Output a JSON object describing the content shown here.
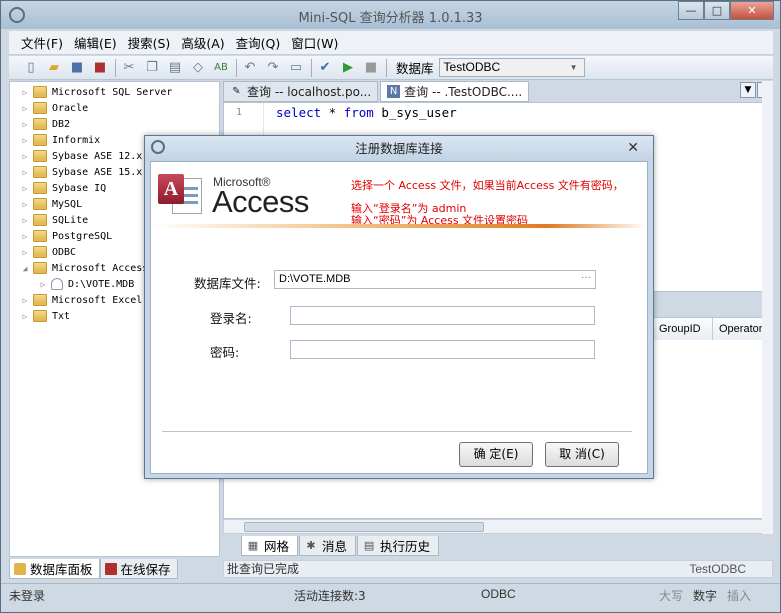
{
  "app": {
    "title": "Mini-SQL 查询分析器 1.0.1.33"
  },
  "window_controls": {
    "minimize": "—",
    "maximize": "□",
    "close": "✕"
  },
  "menu": [
    {
      "label": "文件(F)"
    },
    {
      "label": "编辑(E)"
    },
    {
      "label": "搜索(S)"
    },
    {
      "label": "高级(A)"
    },
    {
      "label": "查询(Q)"
    },
    {
      "label": "窗口(W)"
    }
  ],
  "toolbar": {
    "database_label": "数据库",
    "database_value": "TestODBC",
    "icons": [
      "new-file-icon",
      "open-folder-icon",
      "save-icon",
      "save-all-icon",
      "cut-icon",
      "copy-icon",
      "paste-icon",
      "eraser-icon",
      "replace-icon",
      "undo-icon",
      "redo-icon",
      "form-icon",
      "check-icon",
      "run-icon",
      "stop-icon"
    ]
  },
  "tree": [
    {
      "label": "Microsoft SQL Server",
      "expanded": false
    },
    {
      "label": "Oracle",
      "expanded": false
    },
    {
      "label": "DB2",
      "expanded": false
    },
    {
      "label": "Informix",
      "expanded": false
    },
    {
      "label": "Sybase ASE 12.x",
      "expanded": false
    },
    {
      "label": "Sybase ASE 15.x",
      "expanded": false
    },
    {
      "label": "Sybase IQ",
      "expanded": false
    },
    {
      "label": "MySQL",
      "expanded": false
    },
    {
      "label": "SQLite",
      "expanded": false
    },
    {
      "label": "PostgreSQL",
      "expanded": false
    },
    {
      "label": "ODBC",
      "expanded": false
    },
    {
      "label": "Microsoft Access",
      "expanded": true
    },
    {
      "label": "D:\\VOTE.MDB",
      "child": true
    },
    {
      "label": "Microsoft Excel",
      "expanded": false
    },
    {
      "label": "Txt",
      "expanded": false
    }
  ],
  "left_tabs": [
    {
      "label": "数据库面板",
      "active": true
    },
    {
      "label": "在线保存",
      "active": false
    }
  ],
  "editor_tabs": [
    {
      "label": "查询 -- localhost.po...",
      "active": false
    },
    {
      "label": "查询 -- .TestODBC....",
      "active": true
    }
  ],
  "editor": {
    "line_number": "1",
    "keyword1": "select",
    "code_middle": " * ",
    "keyword2": "from",
    "code_end": " b_sys_user"
  },
  "results": {
    "columns": [
      "GroupID",
      "Operator"
    ]
  },
  "result_tabs": [
    {
      "label": "网格",
      "active": true
    },
    {
      "label": "消息",
      "active": false
    },
    {
      "label": "执行历史",
      "active": false
    }
  ],
  "query_status": {
    "text": "批查询已完成",
    "db": "TestODBC"
  },
  "statusbar": {
    "login": "未登录",
    "connections": "活动连接数:3",
    "driver": "ODBC",
    "caps": "大写",
    "num": "数字",
    "insert": "插入"
  },
  "dialog": {
    "title": "注册数据库连接",
    "close": "✕",
    "logo_ms": "Microsoft®",
    "logo_product": "Access",
    "logo_letter": "A",
    "hint_line1": "选择一个 Access 文件，如果当前Access 文件有密码，",
    "hint_line2": "输入“登录名”为 admin",
    "hint_line3": "输入“密码”为 Access 文件设置密码",
    "db_file_label": "数据库文件:",
    "db_file_value": "D:\\VOTE.MDB",
    "browse": "···",
    "login_label": "登录名:",
    "login_value": "",
    "password_label": "密码:",
    "password_value": "",
    "ok_label": "确 定(E)",
    "cancel_label": "取 消(C)"
  },
  "colors": {
    "hint": "#e00000",
    "keyword": "#0000c8",
    "accent_stripe": "#e07a20"
  }
}
